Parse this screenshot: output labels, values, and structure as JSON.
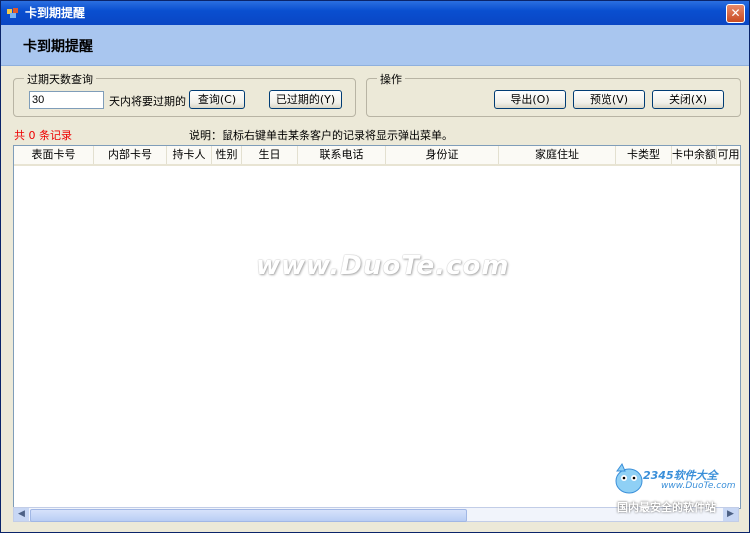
{
  "window": {
    "title": "卡到期提醒",
    "close_glyph": "✕"
  },
  "header": {
    "title": "卡到期提醒"
  },
  "query_group": {
    "legend": "过期天数查询",
    "days_value": "30",
    "days_suffix": "天内将要过期的",
    "query_button": "查询(C)",
    "expired_button": "已过期的(Y)"
  },
  "ops_group": {
    "legend": "操作",
    "export_button": "导出(O)",
    "preview_button": "预览(V)",
    "close_button": "关闭(X)"
  },
  "status": {
    "record_count": "共 0 条记录",
    "note": "说明：鼠标右键单击某条客户的记录将显示弹出菜单。"
  },
  "table": {
    "columns": [
      "表面卡号",
      "内部卡号",
      "持卡人",
      "性别",
      "生日",
      "联系电话",
      "身份证",
      "家庭住址",
      "卡类型",
      "卡中余额",
      "可用"
    ],
    "rows": []
  },
  "watermark": "www.DuoTe.com",
  "badge": {
    "brand": "2345软件大全",
    "site": "www.DuoTe.com",
    "slogan": "国内最安全的软件站"
  },
  "colors": {
    "accent_red": "#ee0000",
    "header_bg": "#a9c6ef",
    "titlebar": "#0a4fd0"
  }
}
